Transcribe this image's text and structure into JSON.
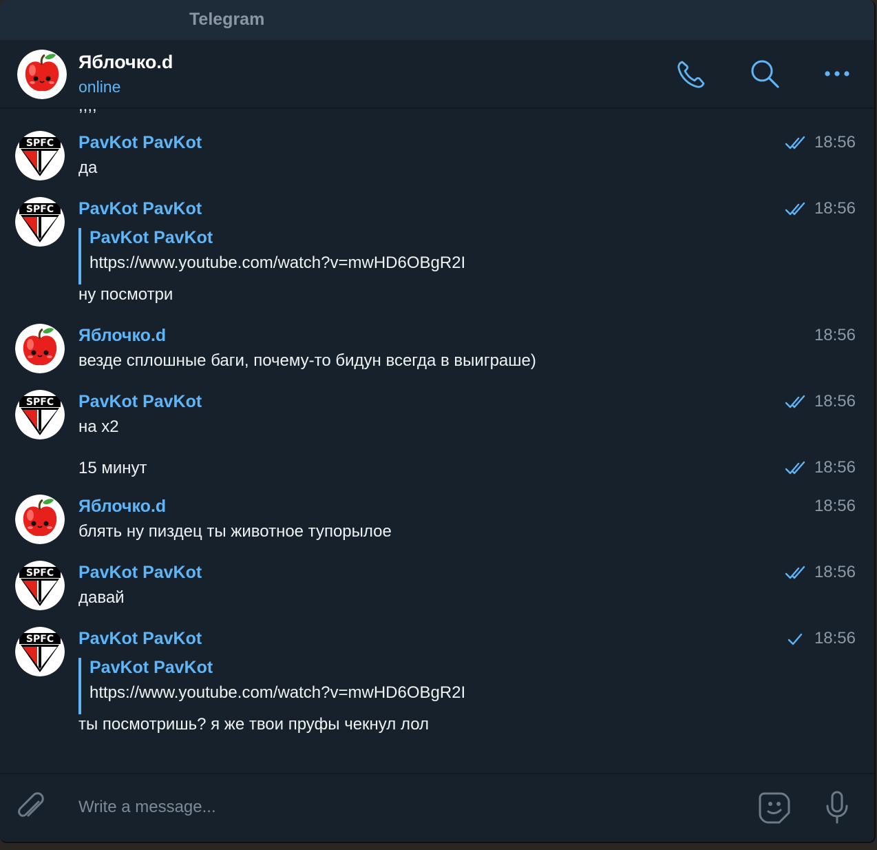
{
  "window": {
    "title": "Telegram"
  },
  "header": {
    "name": "Яблочко.d",
    "status": "online",
    "icons": [
      "phone-icon",
      "search-icon",
      "more-icon"
    ]
  },
  "chat": {
    "cut_text": ",,,,",
    "messages": [
      {
        "sender": "PavKot PavKot",
        "text": "да",
        "time": "18:56",
        "status": "read"
      },
      {
        "sender": "PavKot PavKot",
        "quote_name": "PavKot PavKot",
        "quote_text": "https://www.youtube.com/watch?v=mwHD6OBgR2I",
        "text": "ну посмотри",
        "time": "18:56",
        "status": "read"
      },
      {
        "sender": "Яблочко.d",
        "text": "везде сплошные баги, почему-то бидун всегда в выиграше)",
        "time": "18:56"
      },
      {
        "sender": "PavKot PavKot",
        "text": "на х2",
        "time": "18:56",
        "status": "read"
      },
      {
        "text": "15 минут",
        "time": "18:56",
        "status": "read"
      },
      {
        "sender": "Яблочко.d",
        "text": "блять ну пиздец ты животное тупорылое",
        "time": "18:56"
      },
      {
        "sender": "PavKot PavKot",
        "text": "давай",
        "time": "18:56",
        "status": "read"
      },
      {
        "sender": "PavKot PavKot",
        "quote_name": "PavKot PavKot",
        "quote_text": "https://www.youtube.com/watch?v=mwHD6OBgR2I",
        "text": "ты посмотришь? я же твои пруфы чекнул лол",
        "time": "18:56",
        "status": "sent"
      }
    ]
  },
  "composer": {
    "placeholder": "Write a message...",
    "icons": [
      "paperclip-icon",
      "sticker-icon",
      "microphone-icon"
    ]
  },
  "colors": {
    "background": "#17212b",
    "titlebar": "#1e2c3a",
    "accent": "#5eb5f7",
    "text": "#f0f3f6",
    "muted": "#8d99a6"
  }
}
